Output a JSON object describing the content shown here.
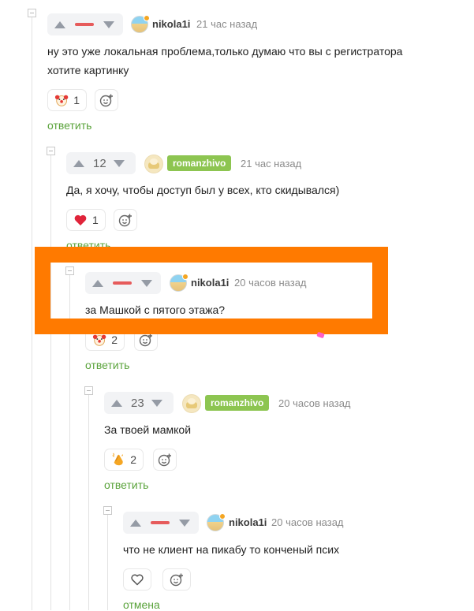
{
  "comments": [
    {
      "rating": "",
      "rating_state": "negative",
      "author": "nikola1i",
      "author_badge": false,
      "time": "21 час назад",
      "text_lines": [
        "ну это уже локальная проблема,только думаю что вы с регистратора",
        "хотите картинку"
      ],
      "reaction": {
        "icon": "clown-icon",
        "count": "1"
      },
      "action": "ответить"
    },
    {
      "rating": "12",
      "author": "romanzhivo",
      "author_badge": true,
      "time": "21 час назад",
      "text_lines": [
        "Да, я хочу, чтобы доступ был у всех, кто скидывался)"
      ],
      "reaction": {
        "icon": "heart-icon",
        "count": "1"
      },
      "action": "ответить"
    },
    {
      "rating": "",
      "rating_state": "negative",
      "author": "nikola1i",
      "author_badge": false,
      "time": "20 часов назад",
      "text_lines": [
        "за Машкой с пятого этажа?"
      ],
      "reaction": {
        "icon": "clown-icon",
        "count": "2"
      },
      "action": "ответить"
    },
    {
      "rating": "23",
      "author": "romanzhivo",
      "author_badge": true,
      "time": "20 часов назад",
      "text_lines": [
        "За твоей мамкой"
      ],
      "reaction": {
        "icon": "clap-icon",
        "count": "2"
      },
      "action": "ответить"
    },
    {
      "rating": "",
      "rating_state": "negative",
      "author": "nikola1i",
      "author_badge": false,
      "time": "20 часов назад",
      "text_lines": [
        "что не клиент на пикабу то конченый псих"
      ],
      "reaction": {
        "icon": "heart-outline-icon",
        "count": ""
      },
      "action": "отмена"
    }
  ],
  "colors": {
    "accent_link": "#5aa33b",
    "badge_green": "#8dc551",
    "negative_dash": "#e65b5b",
    "highlight_orange": "#ff7a00"
  }
}
